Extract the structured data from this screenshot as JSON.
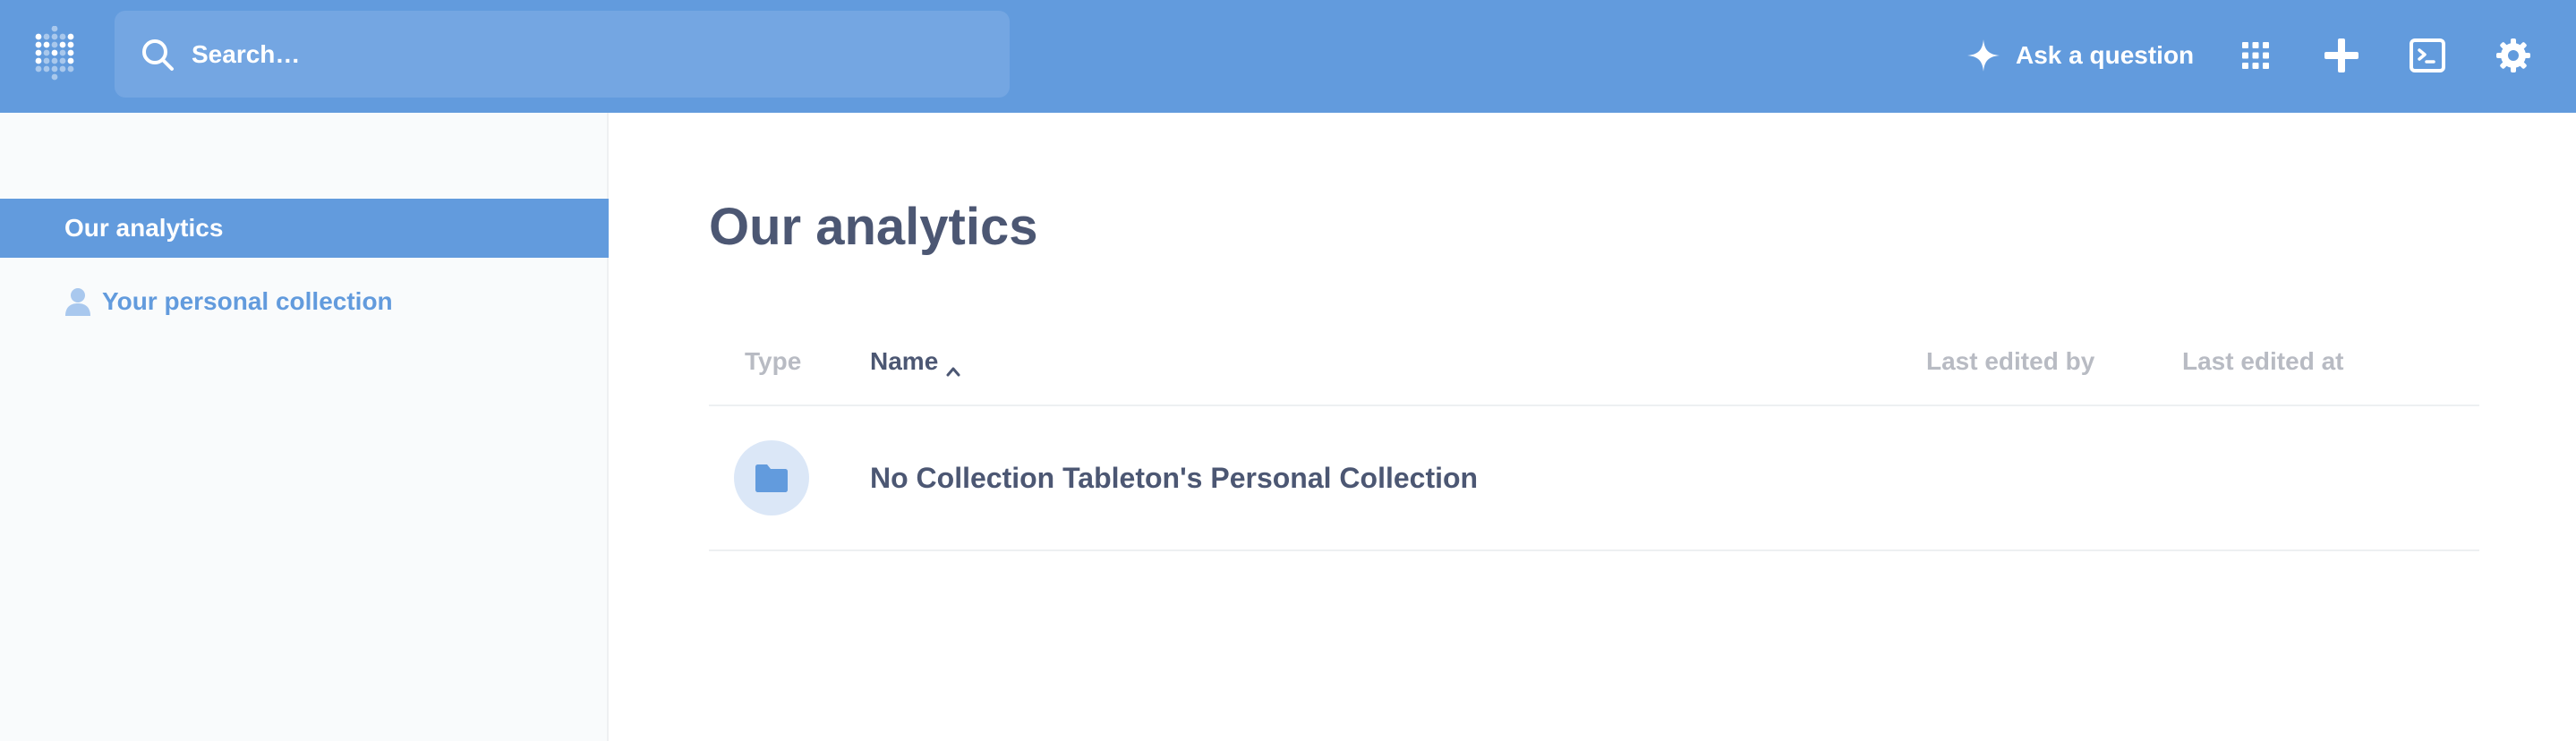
{
  "topbar": {
    "search_placeholder": "Search…",
    "ask_label": "Ask a question"
  },
  "sidebar": {
    "items": [
      {
        "label": "Our analytics",
        "active": true
      },
      {
        "label": "Your personal collection",
        "icon": "person-icon"
      }
    ]
  },
  "main": {
    "title": "Our analytics",
    "columns": [
      "Type",
      "Name",
      "Last edited by",
      "Last edited at"
    ],
    "rows": [
      {
        "type_icon": "folder-icon",
        "name": "No Collection Tableton's Personal Collection"
      }
    ]
  },
  "colors": {
    "brand": "#629bdd",
    "text_dark": "#4c5773",
    "text_light": "#b8bbc3"
  }
}
